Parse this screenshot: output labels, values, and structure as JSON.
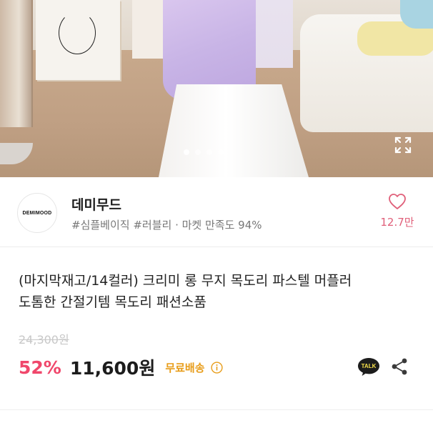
{
  "hero": {
    "slide_count": 4,
    "active_slide": 1,
    "icons": {
      "expand": "expand-icon"
    }
  },
  "seller": {
    "avatar_text": "DEMIMOOD",
    "name": "데미무드",
    "tags": "#심플베이직 #러블리 · 마켓 만족도 94%",
    "like_count": "12.7만",
    "icons": {
      "like": "heart-outline-icon"
    }
  },
  "product": {
    "title_line1": "(마지막재고/14컬러) 크리미 롱 무지 목도리 파스텔 머플러",
    "title_line2": "도톰한 간절기템 목도리 패션소품",
    "original_price": "24,300원",
    "discount": "52%",
    "sale_price": "11,600원",
    "shipping": "무료배송",
    "talk_label": "TALK",
    "icons": {
      "info": "info-circle-icon",
      "talk": "kakao-talk-icon",
      "share": "share-icon"
    }
  },
  "colors": {
    "discount": "#f0476b",
    "like": "#e0607a",
    "free_shipping": "#e89d1a",
    "talk_bubble": "#1c1c1c"
  }
}
